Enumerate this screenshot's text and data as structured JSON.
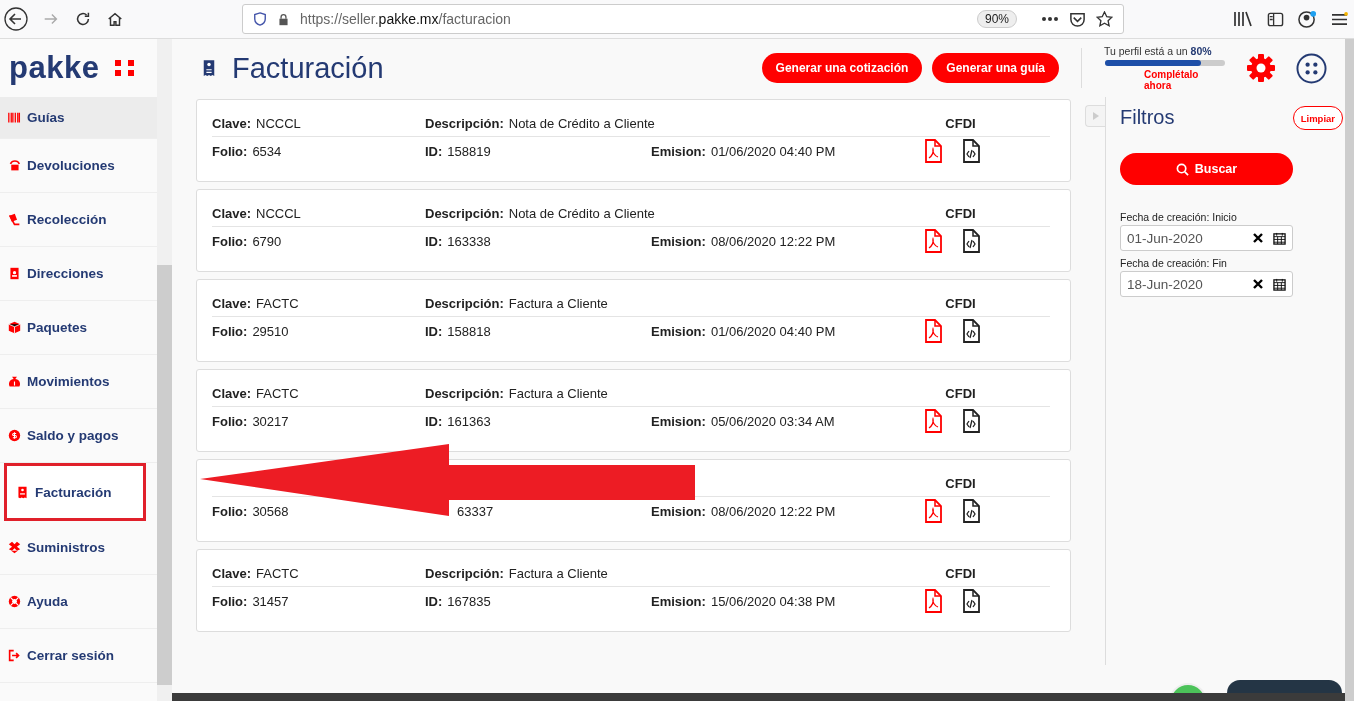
{
  "browser": {
    "url_prefix": "https://seller.",
    "url_domain": "pakke.mx",
    "url_path": "/facturacion",
    "zoom": "90%"
  },
  "logo": "pakke",
  "sidebar": {
    "items": [
      {
        "label": "Guías",
        "selected": true,
        "highlighted": false
      },
      {
        "label": "Devoluciones",
        "selected": false,
        "highlighted": false
      },
      {
        "label": "Recolección",
        "selected": false,
        "highlighted": false
      },
      {
        "label": "Direcciones",
        "selected": false,
        "highlighted": false
      },
      {
        "label": "Paquetes",
        "selected": false,
        "highlighted": false
      },
      {
        "label": "Movimientos",
        "selected": false,
        "highlighted": false
      },
      {
        "label": "Saldo y pagos",
        "selected": false,
        "highlighted": false
      },
      {
        "label": "Facturación",
        "selected": false,
        "highlighted": true
      },
      {
        "label": "Suministros",
        "selected": false,
        "highlighted": false
      },
      {
        "label": "Ayuda",
        "selected": false,
        "highlighted": false
      },
      {
        "label": "Cerrar sesión",
        "selected": false,
        "highlighted": false
      }
    ]
  },
  "header": {
    "title": "Facturación",
    "buttons": [
      "Generar una cotización",
      "Generar una guía"
    ],
    "profile": {
      "text": "Tu perfil está a un **80%**",
      "level": 0.8,
      "link": "Complétalo ahora"
    }
  },
  "invoices": [
    {
      "clave_label": "Clave:",
      "clave": "NCCCL",
      "descripcion_label": "Descripción:",
      "descripcion": "Nota de Crédito a Cliente",
      "cfdi": "CFDI",
      "folio_label": "Folio:",
      "folio": "6534",
      "id_label": "ID:",
      "id": "158819",
      "emision_label": "Emision:",
      "emision": "01/06/2020 04:40 PM"
    },
    {
      "clave_label": "Clave:",
      "clave": "NCCCL",
      "descripcion_label": "Descripción:",
      "descripcion": "Nota de Crédito a Cliente",
      "cfdi": "CFDI",
      "folio_label": "Folio:",
      "folio": "6790",
      "id_label": "ID:",
      "id": "163338",
      "emision_label": "Emision:",
      "emision": "08/06/2020 12:22 PM"
    },
    {
      "clave_label": "Clave:",
      "clave": "FACTC",
      "descripcion_label": "Descripción:",
      "descripcion": "Factura a Cliente",
      "cfdi": "CFDI",
      "folio_label": "Folio:",
      "folio": "29510",
      "id_label": "ID:",
      "id": "158818",
      "emision_label": "Emision:",
      "emision": "01/06/2020 04:40 PM"
    },
    {
      "clave_label": "Clave:",
      "clave": "FACTC",
      "descripcion_label": "Descripción:",
      "descripcion": "Factura a Cliente",
      "cfdi": "CFDI",
      "folio_label": "Folio:",
      "folio": "30217",
      "id_label": "ID:",
      "id": "161363",
      "emision_label": "Emision:",
      "emision": "05/06/2020 03:34 AM"
    },
    {
      "cfdi": "CFDI",
      "folio_label": "Folio:",
      "folio": "30568",
      "id": "63337",
      "emision_label": "Emision:",
      "emision": "08/06/2020 12:22 PM"
    },
    {
      "clave_label": "Clave:",
      "clave": "FACTC",
      "descripcion_label": "Descripción:",
      "descripcion": "Factura a Cliente",
      "cfdi": "CFDI",
      "folio_label": "Folio:",
      "folio": "31457",
      "id_label": "ID:",
      "id": "167835",
      "emision_label": "Emision:",
      "emision": "15/06/2020 04:38 PM"
    }
  ],
  "filters": {
    "title": "Filtros",
    "clear": "Limpiar",
    "search": "Buscar",
    "fields": [
      {
        "label": "Fecha de creación: Inicio",
        "value": "01-Jun-2020"
      },
      {
        "label": "Fecha de creación: Fin",
        "value": "18-Jun-2020"
      }
    ]
  },
  "annotation": {
    "arrow": true
  }
}
